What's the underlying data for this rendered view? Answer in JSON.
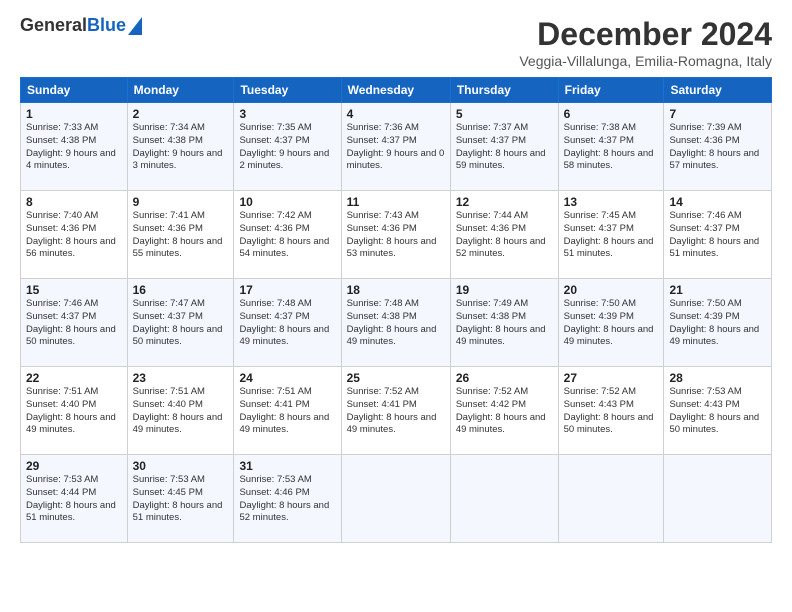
{
  "logo": {
    "general": "General",
    "blue": "Blue"
  },
  "header": {
    "title": "December 2024",
    "subtitle": "Veggia-Villalunga, Emilia-Romagna, Italy"
  },
  "calendar": {
    "headers": [
      "Sunday",
      "Monday",
      "Tuesday",
      "Wednesday",
      "Thursday",
      "Friday",
      "Saturday"
    ],
    "weeks": [
      [
        {
          "day": "1",
          "sunrise": "7:33 AM",
          "sunset": "4:38 PM",
          "daylight": "9 hours and 4 minutes."
        },
        {
          "day": "2",
          "sunrise": "7:34 AM",
          "sunset": "4:38 PM",
          "daylight": "9 hours and 3 minutes."
        },
        {
          "day": "3",
          "sunrise": "7:35 AM",
          "sunset": "4:37 PM",
          "daylight": "9 hours and 2 minutes."
        },
        {
          "day": "4",
          "sunrise": "7:36 AM",
          "sunset": "4:37 PM",
          "daylight": "9 hours and 0 minutes."
        },
        {
          "day": "5",
          "sunrise": "7:37 AM",
          "sunset": "4:37 PM",
          "daylight": "8 hours and 59 minutes."
        },
        {
          "day": "6",
          "sunrise": "7:38 AM",
          "sunset": "4:37 PM",
          "daylight": "8 hours and 58 minutes."
        },
        {
          "day": "7",
          "sunrise": "7:39 AM",
          "sunset": "4:36 PM",
          "daylight": "8 hours and 57 minutes."
        }
      ],
      [
        {
          "day": "8",
          "sunrise": "7:40 AM",
          "sunset": "4:36 PM",
          "daylight": "8 hours and 56 minutes."
        },
        {
          "day": "9",
          "sunrise": "7:41 AM",
          "sunset": "4:36 PM",
          "daylight": "8 hours and 55 minutes."
        },
        {
          "day": "10",
          "sunrise": "7:42 AM",
          "sunset": "4:36 PM",
          "daylight": "8 hours and 54 minutes."
        },
        {
          "day": "11",
          "sunrise": "7:43 AM",
          "sunset": "4:36 PM",
          "daylight": "8 hours and 53 minutes."
        },
        {
          "day": "12",
          "sunrise": "7:44 AM",
          "sunset": "4:36 PM",
          "daylight": "8 hours and 52 minutes."
        },
        {
          "day": "13",
          "sunrise": "7:45 AM",
          "sunset": "4:37 PM",
          "daylight": "8 hours and 51 minutes."
        },
        {
          "day": "14",
          "sunrise": "7:46 AM",
          "sunset": "4:37 PM",
          "daylight": "8 hours and 51 minutes."
        }
      ],
      [
        {
          "day": "15",
          "sunrise": "7:46 AM",
          "sunset": "4:37 PM",
          "daylight": "8 hours and 50 minutes."
        },
        {
          "day": "16",
          "sunrise": "7:47 AM",
          "sunset": "4:37 PM",
          "daylight": "8 hours and 50 minutes."
        },
        {
          "day": "17",
          "sunrise": "7:48 AM",
          "sunset": "4:37 PM",
          "daylight": "8 hours and 49 minutes."
        },
        {
          "day": "18",
          "sunrise": "7:48 AM",
          "sunset": "4:38 PM",
          "daylight": "8 hours and 49 minutes."
        },
        {
          "day": "19",
          "sunrise": "7:49 AM",
          "sunset": "4:38 PM",
          "daylight": "8 hours and 49 minutes."
        },
        {
          "day": "20",
          "sunrise": "7:50 AM",
          "sunset": "4:39 PM",
          "daylight": "8 hours and 49 minutes."
        },
        {
          "day": "21",
          "sunrise": "7:50 AM",
          "sunset": "4:39 PM",
          "daylight": "8 hours and 49 minutes."
        }
      ],
      [
        {
          "day": "22",
          "sunrise": "7:51 AM",
          "sunset": "4:40 PM",
          "daylight": "8 hours and 49 minutes."
        },
        {
          "day": "23",
          "sunrise": "7:51 AM",
          "sunset": "4:40 PM",
          "daylight": "8 hours and 49 minutes."
        },
        {
          "day": "24",
          "sunrise": "7:51 AM",
          "sunset": "4:41 PM",
          "daylight": "8 hours and 49 minutes."
        },
        {
          "day": "25",
          "sunrise": "7:52 AM",
          "sunset": "4:41 PM",
          "daylight": "8 hours and 49 minutes."
        },
        {
          "day": "26",
          "sunrise": "7:52 AM",
          "sunset": "4:42 PM",
          "daylight": "8 hours and 49 minutes."
        },
        {
          "day": "27",
          "sunrise": "7:52 AM",
          "sunset": "4:43 PM",
          "daylight": "8 hours and 50 minutes."
        },
        {
          "day": "28",
          "sunrise": "7:53 AM",
          "sunset": "4:43 PM",
          "daylight": "8 hours and 50 minutes."
        }
      ],
      [
        {
          "day": "29",
          "sunrise": "7:53 AM",
          "sunset": "4:44 PM",
          "daylight": "8 hours and 51 minutes."
        },
        {
          "day": "30",
          "sunrise": "7:53 AM",
          "sunset": "4:45 PM",
          "daylight": "8 hours and 51 minutes."
        },
        {
          "day": "31",
          "sunrise": "7:53 AM",
          "sunset": "4:46 PM",
          "daylight": "8 hours and 52 minutes."
        },
        null,
        null,
        null,
        null
      ]
    ]
  }
}
